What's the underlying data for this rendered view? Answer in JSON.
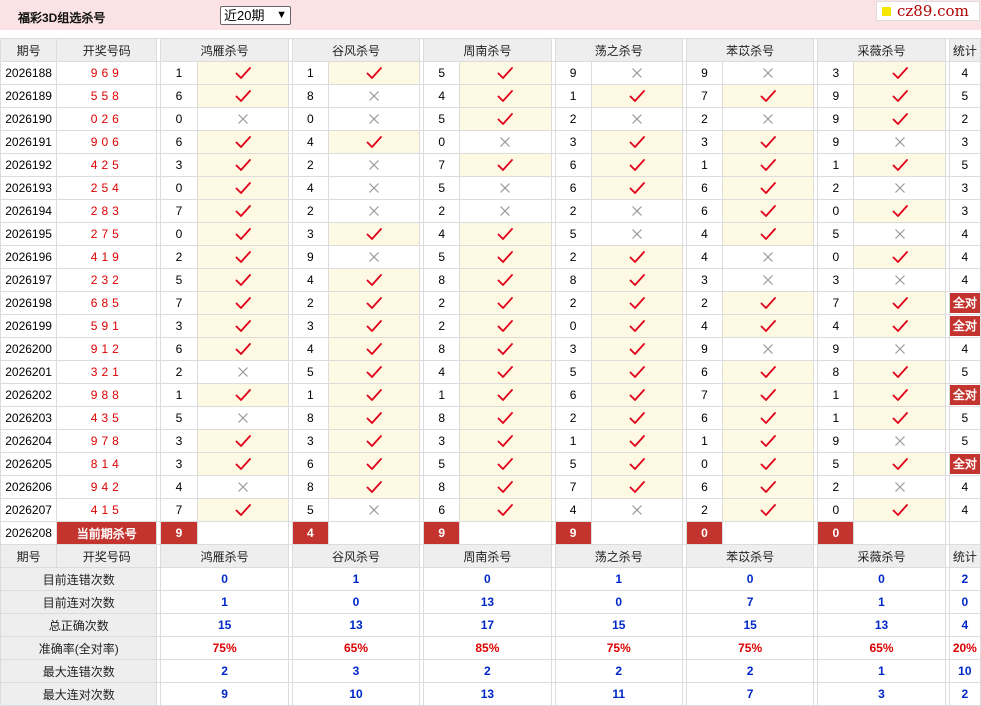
{
  "title": "福彩3D组选杀号",
  "period_select": {
    "value": "近20期"
  },
  "brand": "cz89.com",
  "colors": {
    "draw_number": "#dd0000",
    "all_right_badge": "#c4342f",
    "stat_number": "#0028c8",
    "rate": "#dd0000",
    "hit_cell_bg": "#fdf9e3",
    "header_bg": "#eeeeee",
    "top_bar_bg": "#fbe3e5"
  },
  "icons": {
    "hit": "red-check-mark-icon",
    "miss": "gray-cross-icon"
  },
  "headers": {
    "period": "期号",
    "draw": "开奖号码",
    "experts": [
      "鸿雁杀号",
      "谷风杀号",
      "周南杀号",
      "荡之杀号",
      "苯苡杀号",
      "采薇杀号"
    ],
    "stats": "统计"
  },
  "rows": [
    {
      "period": "2026188",
      "draw": "969",
      "kills": [
        {
          "n": "1",
          "ok": true
        },
        {
          "n": "1",
          "ok": true
        },
        {
          "n": "5",
          "ok": true
        },
        {
          "n": "9",
          "ok": false
        },
        {
          "n": "9",
          "ok": false
        },
        {
          "n": "3",
          "ok": true
        }
      ],
      "stat": "4"
    },
    {
      "period": "2026189",
      "draw": "558",
      "kills": [
        {
          "n": "6",
          "ok": true
        },
        {
          "n": "8",
          "ok": false
        },
        {
          "n": "4",
          "ok": true
        },
        {
          "n": "1",
          "ok": true
        },
        {
          "n": "7",
          "ok": true
        },
        {
          "n": "9",
          "ok": true
        }
      ],
      "stat": "5"
    },
    {
      "period": "2026190",
      "draw": "026",
      "kills": [
        {
          "n": "0",
          "ok": false
        },
        {
          "n": "0",
          "ok": false
        },
        {
          "n": "5",
          "ok": true
        },
        {
          "n": "2",
          "ok": false
        },
        {
          "n": "2",
          "ok": false
        },
        {
          "n": "9",
          "ok": true
        }
      ],
      "stat": "2"
    },
    {
      "period": "2026191",
      "draw": "906",
      "kills": [
        {
          "n": "6",
          "ok": true
        },
        {
          "n": "4",
          "ok": true
        },
        {
          "n": "0",
          "ok": false
        },
        {
          "n": "3",
          "ok": true
        },
        {
          "n": "3",
          "ok": true
        },
        {
          "n": "9",
          "ok": false
        }
      ],
      "stat": "3"
    },
    {
      "period": "2026192",
      "draw": "425",
      "kills": [
        {
          "n": "3",
          "ok": true
        },
        {
          "n": "2",
          "ok": false
        },
        {
          "n": "7",
          "ok": true
        },
        {
          "n": "6",
          "ok": true
        },
        {
          "n": "1",
          "ok": true
        },
        {
          "n": "1",
          "ok": true
        }
      ],
      "stat": "5"
    },
    {
      "period": "2026193",
      "draw": "254",
      "kills": [
        {
          "n": "0",
          "ok": true
        },
        {
          "n": "4",
          "ok": false
        },
        {
          "n": "5",
          "ok": false
        },
        {
          "n": "6",
          "ok": true
        },
        {
          "n": "6",
          "ok": true
        },
        {
          "n": "2",
          "ok": false
        }
      ],
      "stat": "3"
    },
    {
      "period": "2026194",
      "draw": "283",
      "kills": [
        {
          "n": "7",
          "ok": true
        },
        {
          "n": "2",
          "ok": false
        },
        {
          "n": "2",
          "ok": false
        },
        {
          "n": "2",
          "ok": false
        },
        {
          "n": "6",
          "ok": true
        },
        {
          "n": "0",
          "ok": true
        }
      ],
      "stat": "3"
    },
    {
      "period": "2026195",
      "draw": "275",
      "kills": [
        {
          "n": "0",
          "ok": true
        },
        {
          "n": "3",
          "ok": true
        },
        {
          "n": "4",
          "ok": true
        },
        {
          "n": "5",
          "ok": false
        },
        {
          "n": "4",
          "ok": true
        },
        {
          "n": "5",
          "ok": false
        }
      ],
      "stat": "4"
    },
    {
      "period": "2026196",
      "draw": "419",
      "kills": [
        {
          "n": "2",
          "ok": true
        },
        {
          "n": "9",
          "ok": false
        },
        {
          "n": "5",
          "ok": true
        },
        {
          "n": "2",
          "ok": true
        },
        {
          "n": "4",
          "ok": false
        },
        {
          "n": "0",
          "ok": true
        }
      ],
      "stat": "4"
    },
    {
      "period": "2026197",
      "draw": "232",
      "kills": [
        {
          "n": "5",
          "ok": true
        },
        {
          "n": "4",
          "ok": true
        },
        {
          "n": "8",
          "ok": true
        },
        {
          "n": "8",
          "ok": true
        },
        {
          "n": "3",
          "ok": false
        },
        {
          "n": "3",
          "ok": false
        }
      ],
      "stat": "4"
    },
    {
      "period": "2026198",
      "draw": "685",
      "kills": [
        {
          "n": "7",
          "ok": true
        },
        {
          "n": "2",
          "ok": true
        },
        {
          "n": "2",
          "ok": true
        },
        {
          "n": "2",
          "ok": true
        },
        {
          "n": "2",
          "ok": true
        },
        {
          "n": "7",
          "ok": true
        }
      ],
      "stat": "全对"
    },
    {
      "period": "2026199",
      "draw": "591",
      "kills": [
        {
          "n": "3",
          "ok": true
        },
        {
          "n": "3",
          "ok": true
        },
        {
          "n": "2",
          "ok": true
        },
        {
          "n": "0",
          "ok": true
        },
        {
          "n": "4",
          "ok": true
        },
        {
          "n": "4",
          "ok": true
        }
      ],
      "stat": "全对"
    },
    {
      "period": "2026200",
      "draw": "912",
      "kills": [
        {
          "n": "6",
          "ok": true
        },
        {
          "n": "4",
          "ok": true
        },
        {
          "n": "8",
          "ok": true
        },
        {
          "n": "3",
          "ok": true
        },
        {
          "n": "9",
          "ok": false
        },
        {
          "n": "9",
          "ok": false
        }
      ],
      "stat": "4"
    },
    {
      "period": "2026201",
      "draw": "321",
      "kills": [
        {
          "n": "2",
          "ok": false
        },
        {
          "n": "5",
          "ok": true
        },
        {
          "n": "4",
          "ok": true
        },
        {
          "n": "5",
          "ok": true
        },
        {
          "n": "6",
          "ok": true
        },
        {
          "n": "8",
          "ok": true
        }
      ],
      "stat": "5"
    },
    {
      "period": "2026202",
      "draw": "988",
      "kills": [
        {
          "n": "1",
          "ok": true
        },
        {
          "n": "1",
          "ok": true
        },
        {
          "n": "1",
          "ok": true
        },
        {
          "n": "6",
          "ok": true
        },
        {
          "n": "7",
          "ok": true
        },
        {
          "n": "1",
          "ok": true
        }
      ],
      "stat": "全对"
    },
    {
      "period": "2026203",
      "draw": "435",
      "kills": [
        {
          "n": "5",
          "ok": false
        },
        {
          "n": "8",
          "ok": true
        },
        {
          "n": "8",
          "ok": true
        },
        {
          "n": "2",
          "ok": true
        },
        {
          "n": "6",
          "ok": true
        },
        {
          "n": "1",
          "ok": true
        }
      ],
      "stat": "5"
    },
    {
      "period": "2026204",
      "draw": "978",
      "kills": [
        {
          "n": "3",
          "ok": true
        },
        {
          "n": "3",
          "ok": true
        },
        {
          "n": "3",
          "ok": true
        },
        {
          "n": "1",
          "ok": true
        },
        {
          "n": "1",
          "ok": true
        },
        {
          "n": "9",
          "ok": false
        }
      ],
      "stat": "5"
    },
    {
      "period": "2026205",
      "draw": "814",
      "kills": [
        {
          "n": "3",
          "ok": true
        },
        {
          "n": "6",
          "ok": true
        },
        {
          "n": "5",
          "ok": true
        },
        {
          "n": "5",
          "ok": true
        },
        {
          "n": "0",
          "ok": true
        },
        {
          "n": "5",
          "ok": true
        }
      ],
      "stat": "全对"
    },
    {
      "period": "2026206",
      "draw": "942",
      "kills": [
        {
          "n": "4",
          "ok": false
        },
        {
          "n": "8",
          "ok": true
        },
        {
          "n": "8",
          "ok": true
        },
        {
          "n": "7",
          "ok": true
        },
        {
          "n": "6",
          "ok": true
        },
        {
          "n": "2",
          "ok": false
        }
      ],
      "stat": "4"
    },
    {
      "period": "2026207",
      "draw": "415",
      "kills": [
        {
          "n": "7",
          "ok": true
        },
        {
          "n": "5",
          "ok": false
        },
        {
          "n": "6",
          "ok": true
        },
        {
          "n": "4",
          "ok": false
        },
        {
          "n": "2",
          "ok": true
        },
        {
          "n": "0",
          "ok": true
        }
      ],
      "stat": "4"
    }
  ],
  "current": {
    "period": "2026208",
    "label": "当前期杀号",
    "kills": [
      "9",
      "4",
      "9",
      "9",
      "0",
      "0"
    ]
  },
  "stats": [
    {
      "label": "目前连错次数",
      "values": [
        "0",
        "1",
        "0",
        "1",
        "0",
        "0"
      ],
      "total": "2"
    },
    {
      "label": "目前连对次数",
      "values": [
        "1",
        "0",
        "13",
        "0",
        "7",
        "1"
      ],
      "total": "0"
    },
    {
      "label": "总正确次数",
      "values": [
        "15",
        "13",
        "17",
        "15",
        "15",
        "13"
      ],
      "total": "4"
    },
    {
      "label": "准确率(全对率)",
      "values": [
        "75%",
        "65%",
        "85%",
        "75%",
        "75%",
        "65%"
      ],
      "total": "20%"
    },
    {
      "label": "最大连错次数",
      "values": [
        "2",
        "3",
        "2",
        "2",
        "2",
        "1"
      ],
      "total": "10"
    },
    {
      "label": "最大连对次数",
      "values": [
        "9",
        "10",
        "13",
        "11",
        "7",
        "3"
      ],
      "total": "2"
    }
  ]
}
